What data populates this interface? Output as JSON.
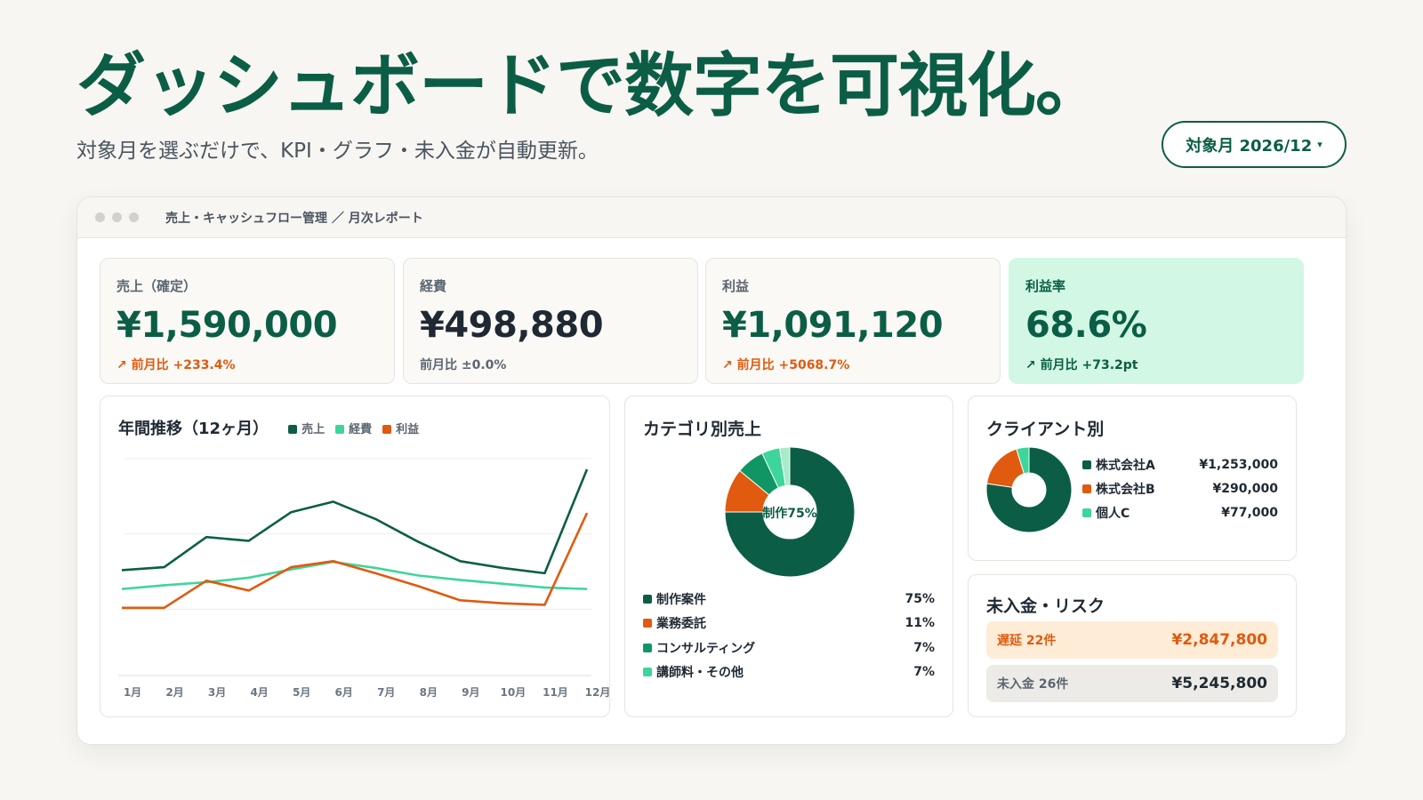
{
  "hero": {
    "title": "ダッシュボードで数字を可視化。",
    "subtitle": "対象月を選ぶだけで、KPI・グラフ・未入金が自動更新。"
  },
  "month_selector": {
    "label": "対象月 2026/12",
    "caret": "▾"
  },
  "window": {
    "title": "売上・キャッシュフロー管理 ／ 月次レポート"
  },
  "kpis": [
    {
      "label": "売上（確定）",
      "value": "¥1,590,000",
      "change": "↗ 前月比 +233.4%",
      "value_color": "#0b5e45",
      "change_color": "#e05a0f"
    },
    {
      "label": "経費",
      "value": "¥498,880",
      "change": "前月比 ±0.0%",
      "value_color": "#1f2933",
      "change_color": "#5b6670"
    },
    {
      "label": "利益",
      "value": "¥1,091,120",
      "change": "↗ 前月比 +5068.7%",
      "value_color": "#0b5e45",
      "change_color": "#e05a0f"
    },
    {
      "label": "利益率",
      "value": "68.6%",
      "change": "↗ 前月比 +73.2pt",
      "value_color": "#0b5e45",
      "change_color": "#0b5e45"
    }
  ],
  "annual": {
    "title": "年間推移（12ヶ月）",
    "legend": [
      "売上",
      "経費",
      "利益"
    ]
  },
  "category": {
    "title": "カテゴリ別売上",
    "center_label": "制作75%",
    "items": [
      {
        "name": "制作案件",
        "pct": "75%",
        "color": "#0b5e45"
      },
      {
        "name": "業務委託",
        "pct": "11%",
        "color": "#e05a0f"
      },
      {
        "name": "コンサルティング",
        "pct": "7%",
        "color": "#0f9664"
      },
      {
        "name": "講師料・その他",
        "pct": "7%",
        "color": "#3dd69a"
      }
    ]
  },
  "clients": {
    "title": "クライアント別",
    "items": [
      {
        "name": "株式会社A",
        "amount": "¥1,253,000",
        "color": "#0b5e45"
      },
      {
        "name": "株式会社B",
        "amount": "¥290,000",
        "color": "#e05a0f"
      },
      {
        "name": "個人C",
        "amount": "¥77,000",
        "color": "#3dd69a"
      }
    ]
  },
  "risk": {
    "title": "未入金・リスク",
    "overdue": {
      "label": "遅延 22件",
      "amount": "¥2,847,800"
    },
    "unpaid": {
      "label": "未入金 26件",
      "amount": "¥5,245,800"
    }
  },
  "chart_data": [
    {
      "type": "line",
      "title": "年間推移（12ヶ月）",
      "categories": [
        "1月",
        "2月",
        "3月",
        "4月",
        "5月",
        "6月",
        "7月",
        "8月",
        "9月",
        "10月",
        "11月",
        "12月"
      ],
      "series": [
        {
          "name": "売上",
          "color": "#0b5e45",
          "values": [
            1400000,
            1440000,
            1840000,
            1790000,
            2170000,
            2310000,
            2080000,
            1780000,
            1520000,
            1430000,
            1360000,
            2740000
          ]
        },
        {
          "name": "経費",
          "color": "#3dd69a",
          "values": [
            1150000,
            1200000,
            1240000,
            1300000,
            1410000,
            1510000,
            1430000,
            1330000,
            1270000,
            1220000,
            1170000,
            1150000
          ]
        },
        {
          "name": "利益",
          "color": "#e05a0f",
          "values": [
            900000,
            900000,
            1260000,
            1130000,
            1440000,
            1520000,
            1360000,
            1190000,
            1000000,
            960000,
            940000,
            2160000
          ]
        }
      ],
      "ylim": [
        0,
        3000000
      ],
      "grid": true,
      "legend": "top"
    },
    {
      "type": "pie",
      "title": "カテゴリ別売上",
      "categories": [
        "制作案件",
        "業務委託",
        "コンサルティング",
        "講師料・その他"
      ],
      "values": [
        75,
        11,
        7,
        7
      ],
      "colors": [
        "#0b5e45",
        "#e05a0f",
        "#0f9664",
        "#3dd69a"
      ],
      "secondary_colors": [
        "#a8ebcb"
      ]
    },
    {
      "type": "pie",
      "title": "クライアント別",
      "categories": [
        "株式会社A",
        "株式会社B",
        "個人C"
      ],
      "values": [
        1253000,
        290000,
        77000
      ],
      "colors": [
        "#0b5e45",
        "#e05a0f",
        "#3dd69a"
      ]
    }
  ]
}
